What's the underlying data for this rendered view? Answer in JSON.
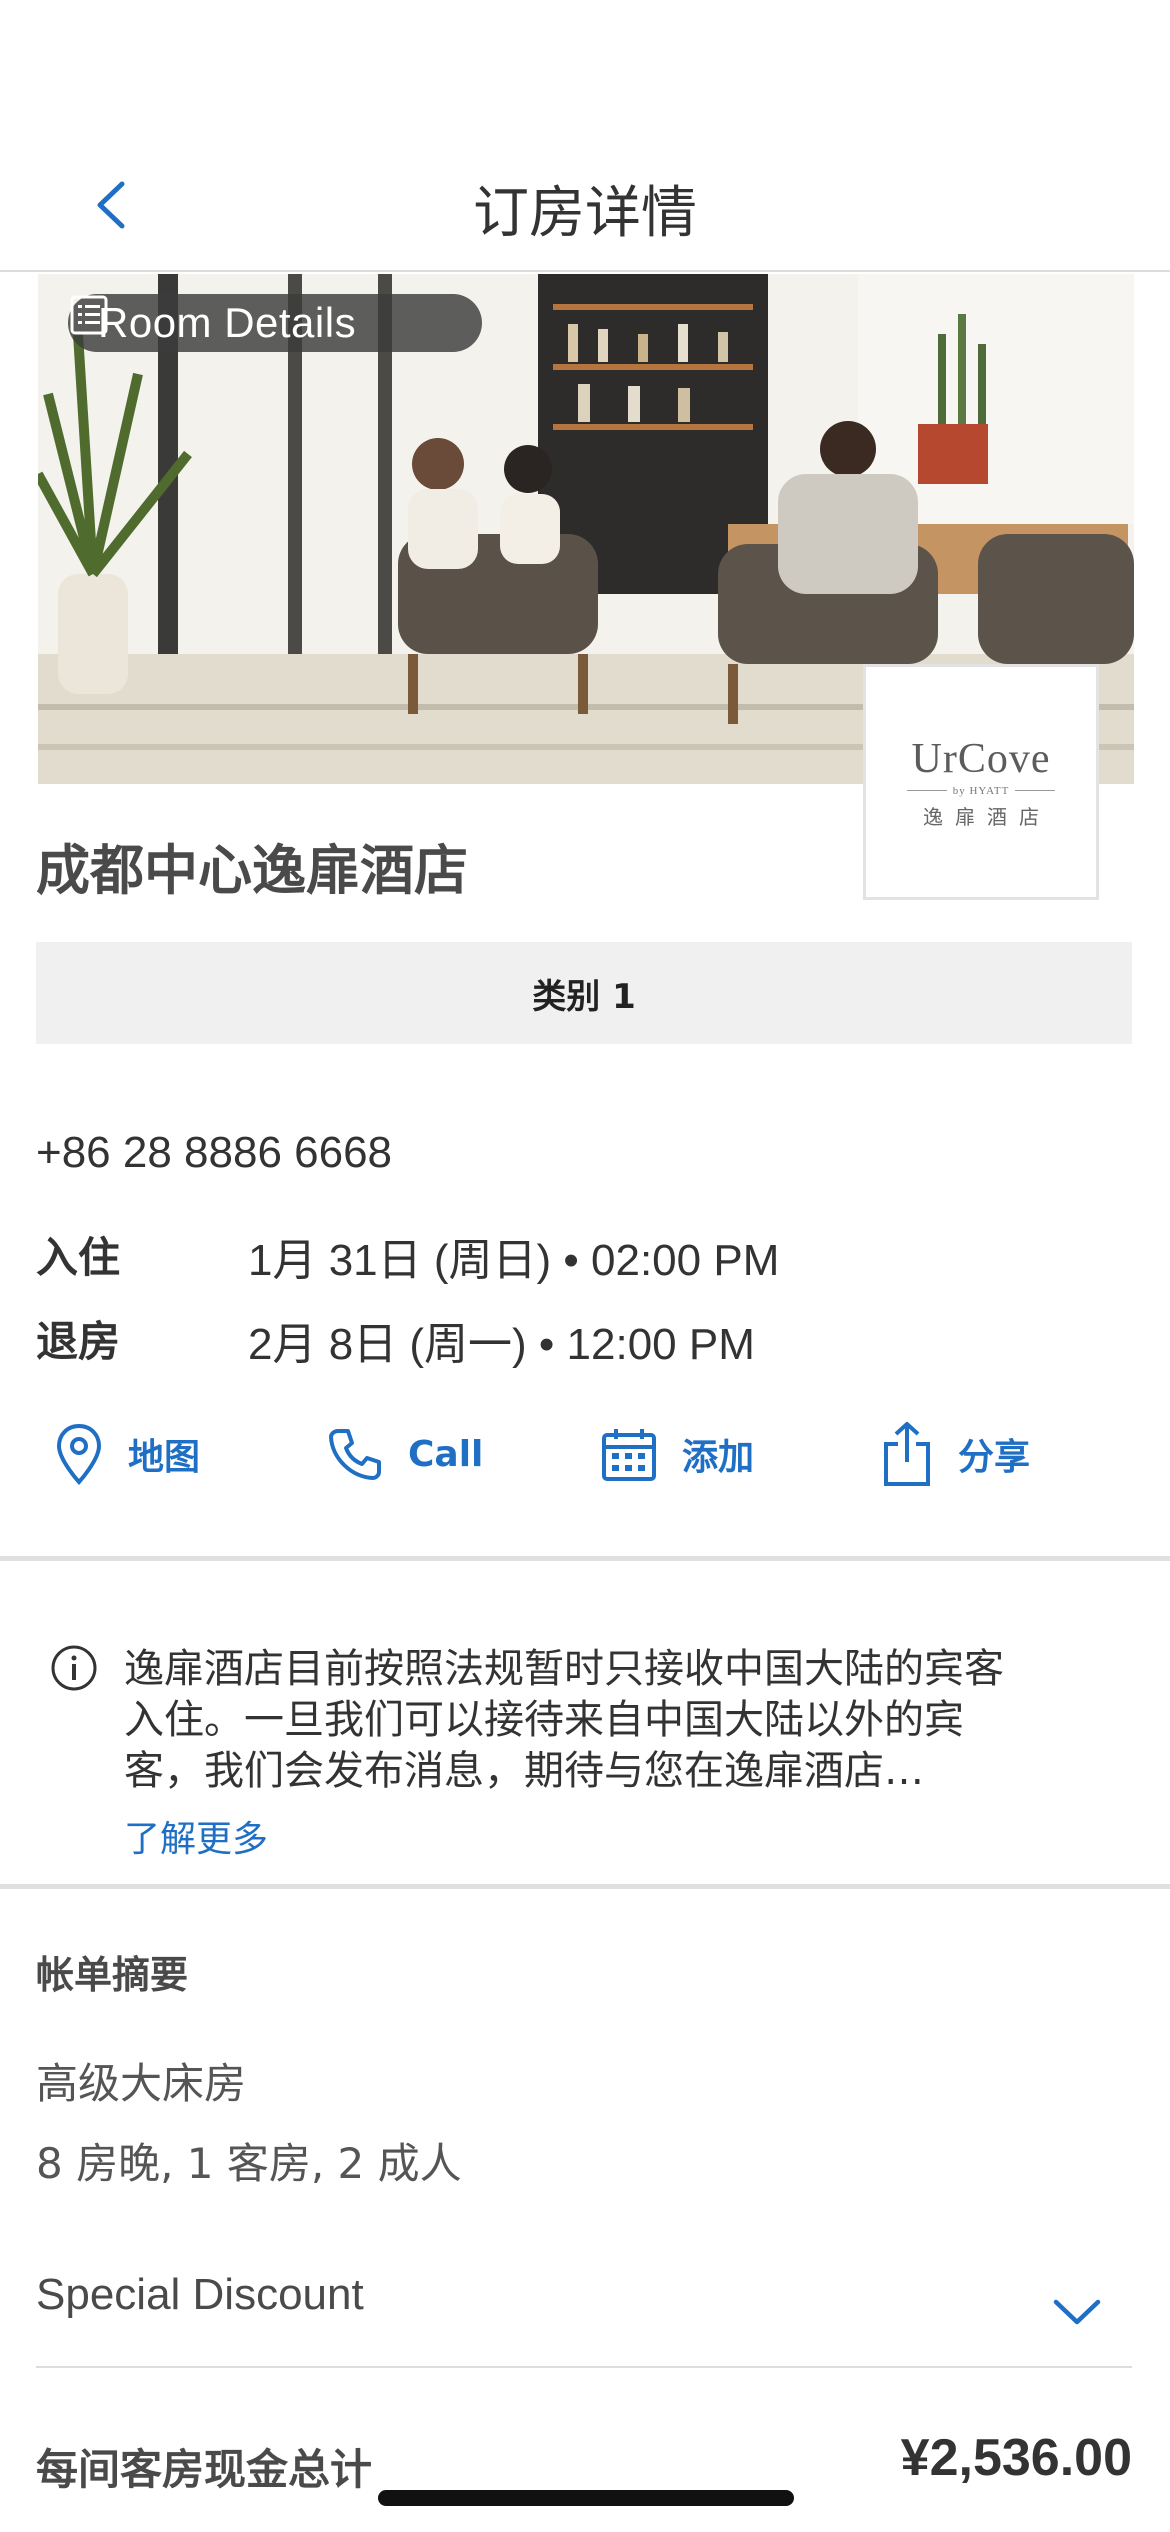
{
  "nav": {
    "title": "订房详情",
    "back_icon": "chevron-left-icon"
  },
  "hero": {
    "pill_label": "Room Details",
    "pill_icon": "list-icon",
    "logo": {
      "brand": "UrCove",
      "sub": "by HYATT",
      "cn": "逸扉酒店"
    }
  },
  "hotel": {
    "name": "成都中心逸扉酒店",
    "category": "类别 1",
    "phone": "+86 28 8886 6668",
    "checkin_label": "入住",
    "checkin_value": "1月 31日 (周日) • 02:00 PM",
    "checkout_label": "退房",
    "checkout_value": "2月 8日 (周一) • 12:00 PM"
  },
  "actions": [
    {
      "label": "地图",
      "icon": "map-pin-icon"
    },
    {
      "label": "Call",
      "icon": "phone-icon"
    },
    {
      "label": "添加",
      "icon": "calendar-icon"
    },
    {
      "label": "分享",
      "icon": "share-icon"
    }
  ],
  "notice": {
    "text": "逸扉酒店目前按照法规暂时只接收中国大陆的宾客入住。一旦我们可以接待来自中国大陆以外的宾客，我们会发布消息，期待与您在逸扉酒店…",
    "more": "了解更多",
    "icon": "info-icon"
  },
  "summary": {
    "title": "帐单摘要",
    "room_type": "高级大床房",
    "room_info": "8 房晚, 1 客房, 2 成人",
    "discount": "Special Discount",
    "total_label": "每间客房现金总计",
    "total_value": "¥2,536.00"
  },
  "colors": {
    "accent": "#1f6fc5",
    "text": "#333333",
    "category_bg": "#f0f0f0"
  }
}
